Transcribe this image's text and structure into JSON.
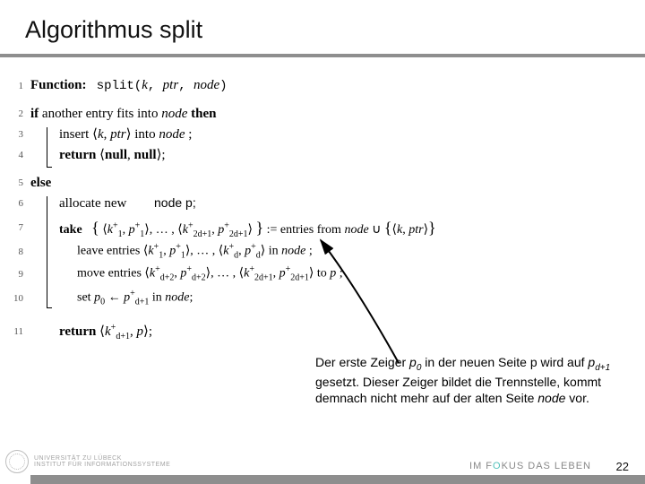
{
  "title": "Algorithmus split",
  "overlay": "node p;",
  "note_parts": {
    "a": "Der erste Zeiger ",
    "p0_base": "p",
    "p0_sub": "0",
    "b": " in der neuen Seite p wird auf ",
    "pd_base": "p",
    "pd_sub": "d+1",
    "c": " gesetzt. Dieser Zeiger bildet die Trennstelle, kommt demnach nicht mehr auf der alten Seite ",
    "node_word": "node",
    "d": " vor."
  },
  "footer": {
    "uni_line1": "UNIVERSITÄT ZU LÜBECK",
    "uni_line2": "INSTITUT FÜR INFORMATIONSSYSTEME",
    "motto_a": "IM F",
    "motto_accent": "O",
    "motto_b": "KUS DAS LEBEN",
    "page": "22"
  },
  "algo": {
    "lines": [
      "1",
      "2",
      "3",
      "4",
      "5",
      "6",
      "7",
      "8",
      "9",
      "10",
      "11"
    ],
    "l1_a": "Function:",
    "l1_b": "split(",
    "l1_c": "k",
    "l1_d": ", ",
    "l1_e": "ptr",
    "l1_f": ", ",
    "l1_g": "node",
    "l1_h": ")",
    "l2_a": "if",
    "l2_b": " another entry fits into ",
    "l2_c": "node",
    "l2_d": " ",
    "l2_e": "then",
    "l3_a": "insert ",
    "l3_b": "k",
    "l3_c": ", ",
    "l3_d": "ptr",
    "l3_e": " into ",
    "l3_f": "node",
    "l3_g": " ;",
    "l4_a": "return",
    "l4_b": "null",
    "l4_c": ", ",
    "l4_d": "null",
    "l4_e": ";",
    "l5_a": "else",
    "l6_a": "allocate new ",
    "l7_a": "take",
    "l7_set_open": "⟨",
    "l7_set_close": "⟩",
    "l7_k": "k",
    "l7_p": "p",
    "l7_plus": "+",
    "l7_1": "1",
    "l7_2d": "2d",
    "l7_2d1": "2d+1",
    "l7_assign": " := entries from ",
    "l7_node": "node",
    "l7_cup": " ∪ ",
    "l7_k2": "k",
    "l7_ptr": "ptr",
    "l8_a": "leave entries ",
    "l8_d": "d",
    "l8_in": " in ",
    "l8_node": "node",
    "l8_semi": " ;",
    "l9_a": "move entries ",
    "l9_d2": "d+2",
    "l9_to": " to ",
    "l9_p": "p",
    "l9_semi": " ;",
    "l10_a": "set ",
    "l10_p0": "p",
    "l10_zero": "0",
    "l10_arrow": " ← ",
    "l10_pd1": "p",
    "l10_d1": "d+1",
    "l10_in": " in ",
    "l10_node": "node",
    "l10_semi": ";",
    "l11_a": "return",
    "l11_k": "k",
    "l11_d1": "d+1",
    "l11_c": ", ",
    "l11_p": "p",
    "l11_semi": ";"
  }
}
